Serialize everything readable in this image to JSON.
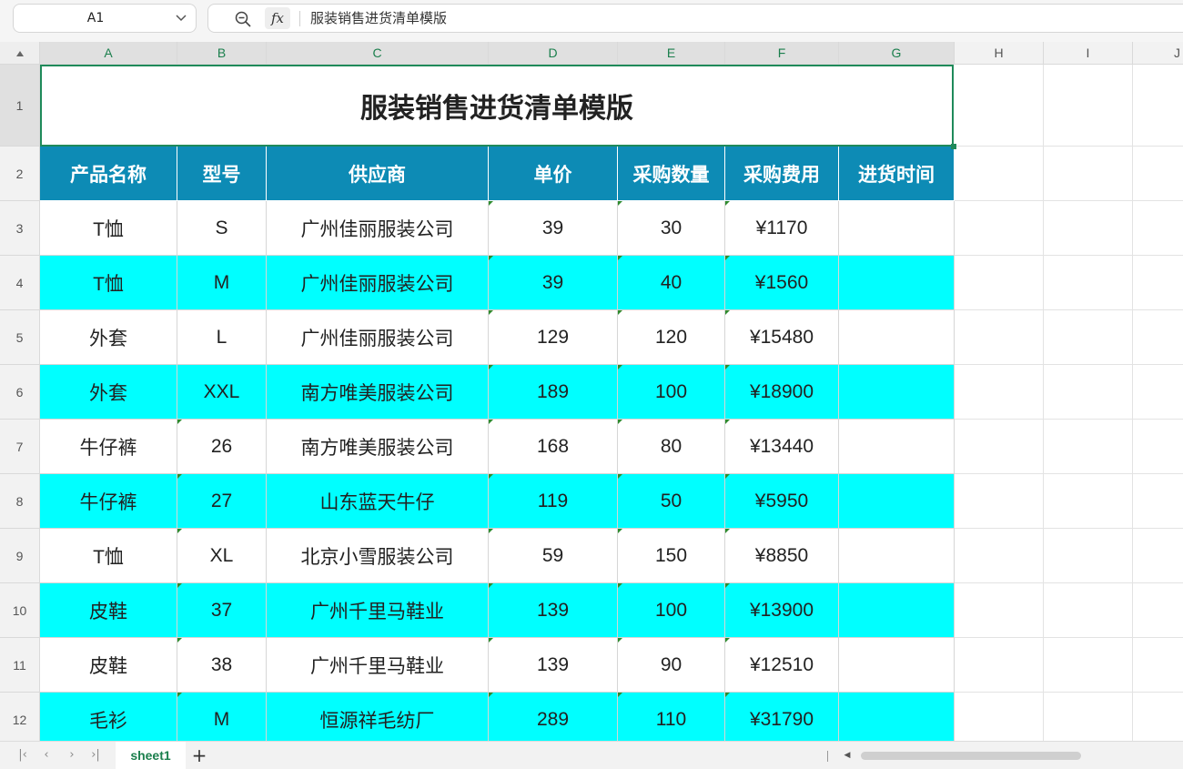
{
  "name_box": {
    "value": "A1"
  },
  "formula_bar": {
    "fx_label": "fx",
    "content": "服装销售进货清单模版"
  },
  "columns": [
    "A",
    "B",
    "C",
    "D",
    "E",
    "F",
    "G",
    "H",
    "I",
    "J"
  ],
  "rows": [
    "1",
    "2",
    "3",
    "4",
    "5",
    "6",
    "7",
    "8",
    "9",
    "10",
    "11",
    "12"
  ],
  "sheet": {
    "title": "服装销售进货清单模版",
    "headers": [
      "产品名称",
      "型号",
      "供应商",
      "单价",
      "采购数量",
      "采购费用",
      "进货时间"
    ],
    "data": [
      [
        "T恤",
        "S",
        "广州佳丽服装公司",
        "39",
        "30",
        "¥1170",
        ""
      ],
      [
        "T恤",
        "M",
        "广州佳丽服装公司",
        "39",
        "40",
        "¥1560",
        ""
      ],
      [
        "外套",
        "L",
        "广州佳丽服装公司",
        "129",
        "120",
        "¥15480",
        ""
      ],
      [
        "外套",
        "XXL",
        "南方唯美服装公司",
        "189",
        "100",
        "¥18900",
        ""
      ],
      [
        "牛仔裤",
        "26",
        "南方唯美服装公司",
        "168",
        "80",
        "¥13440",
        ""
      ],
      [
        "牛仔裤",
        "27",
        "山东蓝天牛仔",
        "119",
        "50",
        "¥5950",
        ""
      ],
      [
        "T恤",
        "XL",
        "北京小雪服装公司",
        "59",
        "150",
        "¥8850",
        ""
      ],
      [
        "皮鞋",
        "37",
        "广州千里马鞋业",
        "139",
        "100",
        "¥13900",
        ""
      ],
      [
        "皮鞋",
        "38",
        "广州千里马鞋业",
        "139",
        "90",
        "¥12510",
        ""
      ],
      [
        "毛衫",
        "M",
        "恒源祥毛纺厂",
        "289",
        "110",
        "¥31790",
        ""
      ]
    ]
  },
  "tabs": [
    {
      "label": "sheet1",
      "active": true
    }
  ],
  "colors": {
    "header_fill": "#0d8bb5",
    "alt_row_fill": "#00ffff",
    "selection": "#1f8a5a",
    "active_tab_text": "#1b7f4d"
  }
}
